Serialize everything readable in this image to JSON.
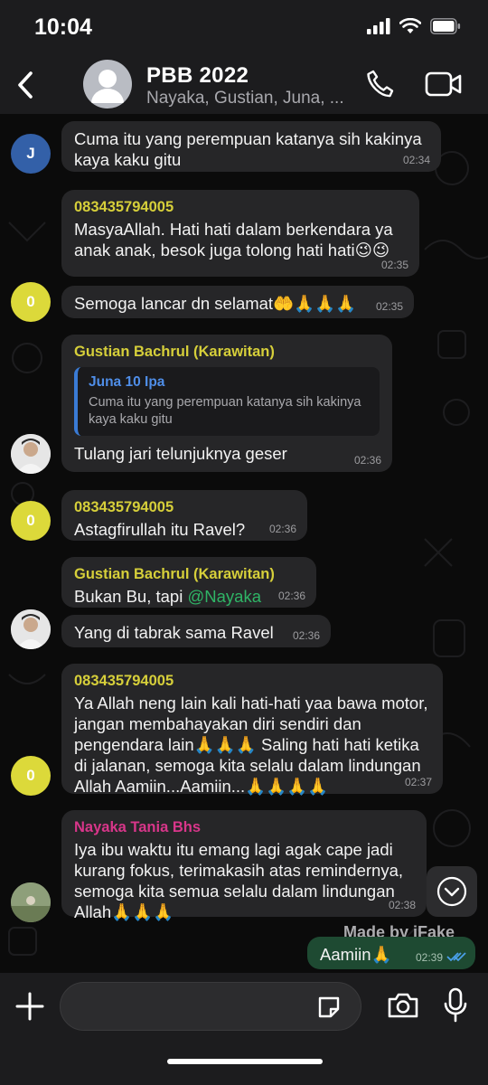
{
  "status_bar": {
    "time": "10:04"
  },
  "header": {
    "title": "PBB 2022",
    "members": "Nayaka, Gustian, Juna, ..."
  },
  "messages": [
    {
      "avatar_letter": "J",
      "text": "Cuma itu yang perempuan katanya sih kakinya kaya kaku gitu",
      "time": "02:34"
    },
    {
      "sender": "083435794005",
      "text": "MasyaAllah. Hati hati dalam berkendara ya anak anak, besok juga tolong hati hati😉😉",
      "time": "02:35"
    },
    {
      "avatar_letter": "0",
      "text": "Semoga lancar dn selamat🤲🙏🙏🙏",
      "time": "02:35"
    },
    {
      "sender": "Gustian Bachrul (Karawitan)",
      "quote_name": "Juna 10 Ipa",
      "quote_text": "Cuma itu yang perempuan katanya sih kakinya kaya kaku gitu",
      "text": "Tulang jari telunjuknya geser",
      "time": "02:36"
    },
    {
      "sender": "083435794005",
      "avatar_letter": "0",
      "text": "Astagfirullah itu Ravel?",
      "time": "02:36"
    },
    {
      "sender": "Gustian Bachrul (Karawitan)",
      "text_prefix": "Bukan Bu, tapi ",
      "mention": "@Nayaka",
      "time": "02:36"
    },
    {
      "text": "Yang di tabrak sama Ravel",
      "time": "02:36"
    },
    {
      "sender": "083435794005",
      "avatar_letter": "0",
      "text": "Ya Allah neng lain kali hati-hati yaa bawa motor, jangan membahayakan diri sendiri dan pengendara lain🙏🙏🙏 Saling hati hati ketika di jalanan, semoga kita selalu dalam lindungan Allah Aamiin...Aamiin...🙏🙏🙏🙏",
      "time": "02:37"
    },
    {
      "sender": "Nayaka Tania Bhs",
      "text": "Iya ibu waktu itu emang lagi agak cape jadi kurang fokus, terimakasih atas remindernya, semoga kita semua selalu dalam lindungan Allah🙏🙏🙏",
      "time": "02:38"
    },
    {
      "text": "Aamiin🙏",
      "time": "02:39",
      "outgoing": true
    }
  ],
  "watermark": "Made by iFake",
  "icons": {
    "back": "chevron-left-icon",
    "call": "phone-icon",
    "video": "video-camera-icon",
    "scroll": "chevron-down-icon",
    "plus": "plus-icon",
    "sticker": "sticker-icon",
    "camera": "camera-icon",
    "mic": "microphone-icon",
    "read": "double-check-icon"
  },
  "colors": {
    "sender_yellow": "#d6cf3a",
    "sender_pink": "#d8368a",
    "mention": "#2fb566",
    "outgoing_bubble": "#1e4a32",
    "incoming_bubble": "#262628",
    "read_check": "#4a9fe8"
  }
}
